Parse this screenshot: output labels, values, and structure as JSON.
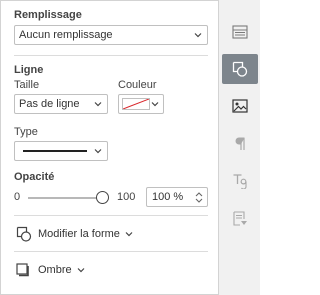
{
  "fill": {
    "section_label": "Remplissage",
    "selected": "Aucun remplissage"
  },
  "line": {
    "section_label": "Ligne",
    "size_label": "Taille",
    "size_selected": "Pas de ligne",
    "color_label": "Couleur",
    "type_label": "Type"
  },
  "opacity": {
    "section_label": "Opacité",
    "min_label": "0",
    "max_label": "100",
    "value": "100 %",
    "level_percent": 100
  },
  "shape": {
    "change_label": "Modifier la forme"
  },
  "shadow": {
    "label": "Ombre"
  },
  "rail": {
    "icons": [
      "table-settings-icon",
      "shape-settings-icon",
      "image-settings-icon",
      "paragraph-settings-icon",
      "text-art-settings-icon",
      "signature-settings-icon"
    ],
    "active_index": 1
  },
  "colors": {
    "active_rail": "#7d858c",
    "no_color_slash": "#d9262b"
  }
}
